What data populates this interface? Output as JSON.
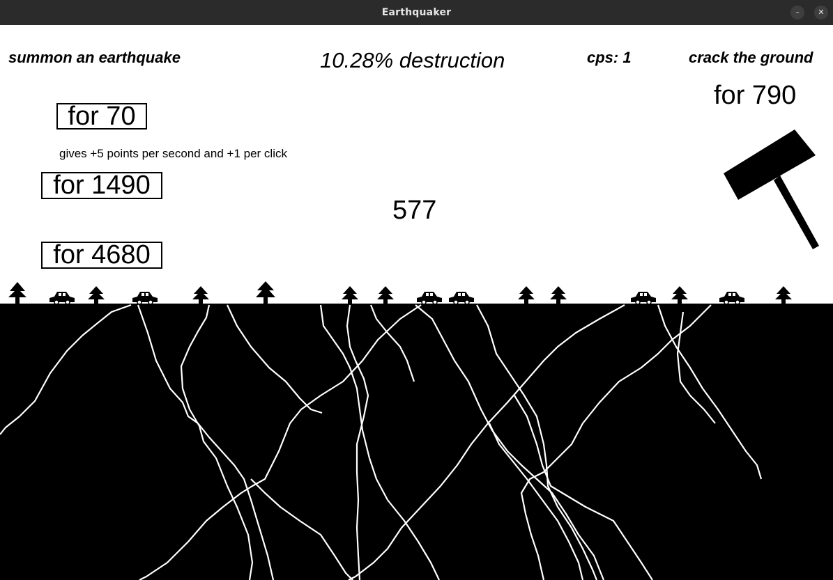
{
  "window": {
    "title": "Earthquaker",
    "minimize_glyph": "–",
    "close_glyph": "✕"
  },
  "hud": {
    "summon_label": "summon an earthquake",
    "destruction": "10.28% destruction",
    "cps": "cps: 1",
    "crack_label": "crack the ground",
    "crack_price": "for 790",
    "score": "577"
  },
  "upgrades": [
    {
      "price": "for 70",
      "description": "gives +5 points per second and +1 per click"
    },
    {
      "price": "for 1490"
    },
    {
      "price": "for 4680"
    }
  ],
  "icons": {
    "hammer": "hammer-icon",
    "tree": "tree-icon",
    "car": "car-icon"
  },
  "colors": {
    "background": "#ffffff",
    "ground": "#000000",
    "cracks": "#ffffff",
    "titlebar": "#2b2b2b"
  }
}
